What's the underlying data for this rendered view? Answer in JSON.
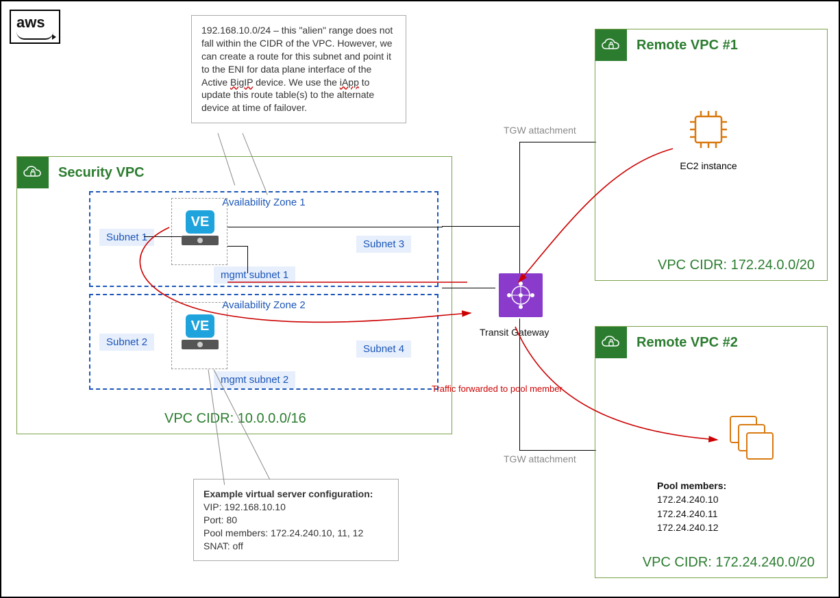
{
  "logo": "aws",
  "callout_top": {
    "text": "192.168.10.0/24 – this \"alien\" range does not fall within the CIDR of the VPC. However, we can create a route for this subnet and point it to the ENI for data plane interface of the Active BigIP device. We use the iApp to update this route table(s) to the alternate device at time of failover.",
    "wavy1": "BigIP",
    "wavy2": "iApp"
  },
  "sec_vpc": {
    "title": "Security VPC",
    "az1": "Availability Zone 1",
    "az2": "Availability Zone 2",
    "sub1": "Subnet 1",
    "sub2": "Subnet 2",
    "sub3": "Subnet 3",
    "sub4": "Subnet 4",
    "mgmt1": "mgmt subnet 1",
    "mgmt2": "mgmt subnet 2",
    "cidr": "VPC CIDR: 10.0.0.0/16",
    "ve": "VE"
  },
  "tgw": {
    "label": "Transit Gateway",
    "att": "TGW attachment"
  },
  "rvpc1": {
    "title": "Remote VPC #1",
    "ec2": "EC2 instance",
    "cidr": "VPC CIDR: 172.24.0.0/20"
  },
  "rvpc2": {
    "title": "Remote VPC #2",
    "pm_title": "Pool members:",
    "pm1": "172.24.240.10",
    "pm2": "172.24.240.11",
    "pm3": "172.24.240.12",
    "cidr": "VPC CIDR: 172.24.240.0/20"
  },
  "red1": "Traffic forwarded to pool member",
  "callout_bottom": {
    "title": "Example virtual server configuration:",
    "l1": "VIP: 192.168.10.10",
    "l2": "Port: 80",
    "l3": "Pool members: 172.24.240.10, 11, 12",
    "l4": "SNAT: off"
  }
}
